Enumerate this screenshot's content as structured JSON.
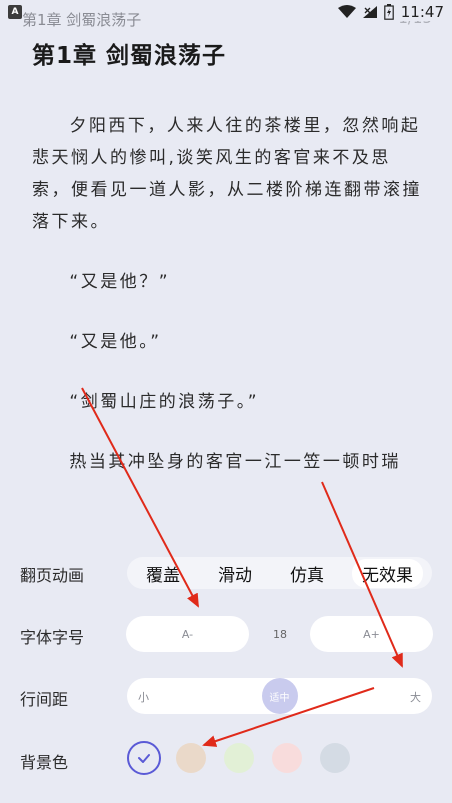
{
  "status_bar": {
    "app_icon_letter": "A",
    "chapter": "第1章 剑蜀浪荡子",
    "page": "1/15",
    "time": "11:47"
  },
  "reader": {
    "chapter_title": "第1章 剑蜀浪荡子",
    "paragraphs": [
      "夕阳西下，人来人往的茶楼里，忽然响起悲天悯人的惨叫,谈笑风生的客官来不及思索，便看见一道人影，从二楼阶梯连翻带滚撞落下来。",
      "“又是他？”",
      "“又是他。”",
      "“剑蜀山庄的浪荡子。”",
      "热当其冲坠身的客官一江一笠一顿时瑞"
    ]
  },
  "settings": {
    "page_animation": {
      "label": "翻页动画",
      "options": [
        "覆盖",
        "滑动",
        "仿真",
        "无效果"
      ],
      "selected": "无效果"
    },
    "font_size": {
      "label": "字体字号",
      "decrease": "A-",
      "value": "18",
      "increase": "A+"
    },
    "line_spacing": {
      "label": "行间距",
      "min": "小",
      "current": "适中",
      "max": "大",
      "level_fraction": 0.5
    },
    "background": {
      "label": "背景色",
      "swatches": [
        "#e8eaf3",
        "#ead9c9",
        "#e2f0d6",
        "#f8dcdc",
        "#d4dbe4"
      ],
      "selected_index": 0
    }
  },
  "colors": {
    "accent": "#5a5ad6",
    "annotation_arrow": "#e02a1a"
  }
}
